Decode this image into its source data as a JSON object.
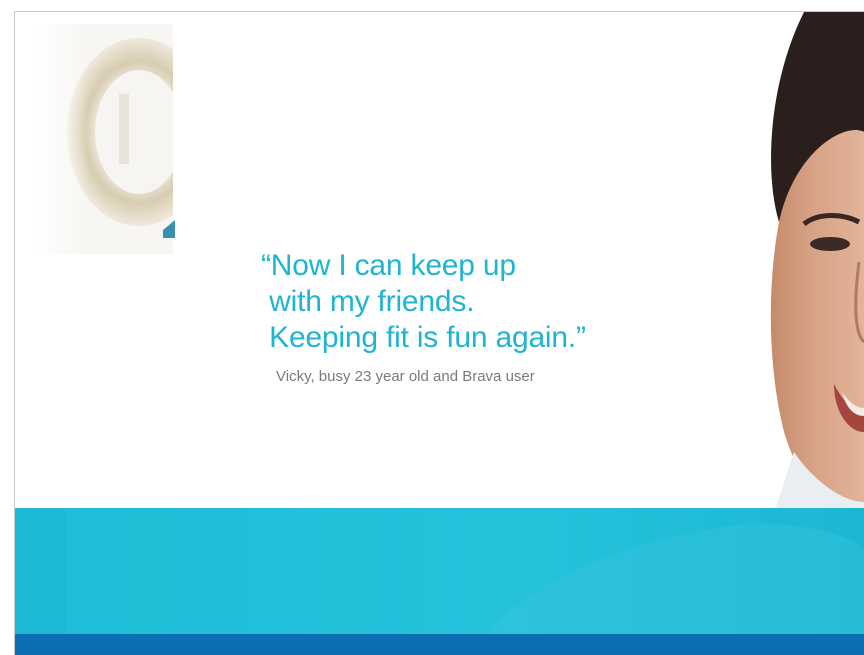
{
  "slide": {
    "quote_lines": [
      "“Now I can keep up",
      " with my friends.",
      " Keeping fit is fun again.”"
    ],
    "attribution": "Vicky, busy 23 year old and Brava user"
  },
  "colors": {
    "quote_text": "#1eb4d2",
    "attribution_text": "#7a7a7a",
    "band_cyan": "#22bfd9",
    "band_blue": "#0d6fb3"
  },
  "images": {
    "product": "ostomy-ring-product-photo",
    "portrait": "smiling-woman-portrait-photo"
  }
}
